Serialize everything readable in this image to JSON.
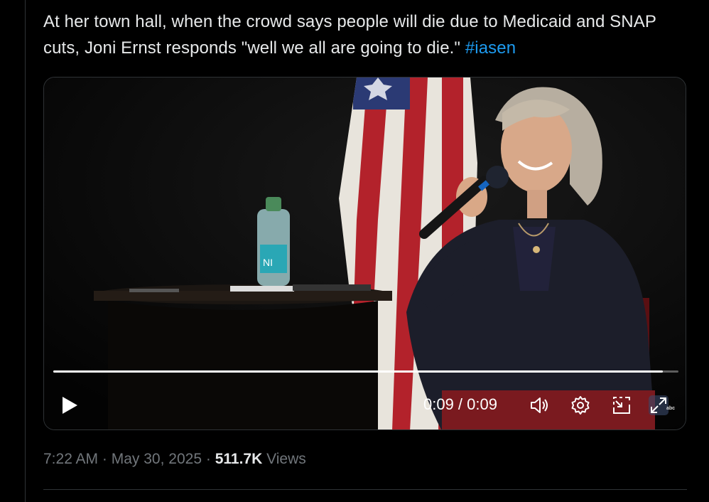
{
  "tweet": {
    "text": "At her town hall, when the crowd says people will die due to Medicaid and SNAP cuts, Joni Ernst responds \"well we all are going to die.\"",
    "hashtag": "#iasen"
  },
  "video": {
    "time_display": "0:09 / 0:09",
    "progress": 0.975,
    "controls": [
      "play-icon",
      "volume-icon",
      "settings-icon",
      "pip-icon",
      "fullscreen-icon"
    ],
    "watermark": "abc"
  },
  "meta": {
    "time": "7:22 AM",
    "date": "May 30, 2025",
    "views_count": "511.7K",
    "views_label": "Views",
    "separator": "·"
  },
  "colors": {
    "background": "#000000",
    "text": "#e7e9ea",
    "muted": "#71767b",
    "link": "#1d9bf0",
    "border": "#2f3336"
  }
}
